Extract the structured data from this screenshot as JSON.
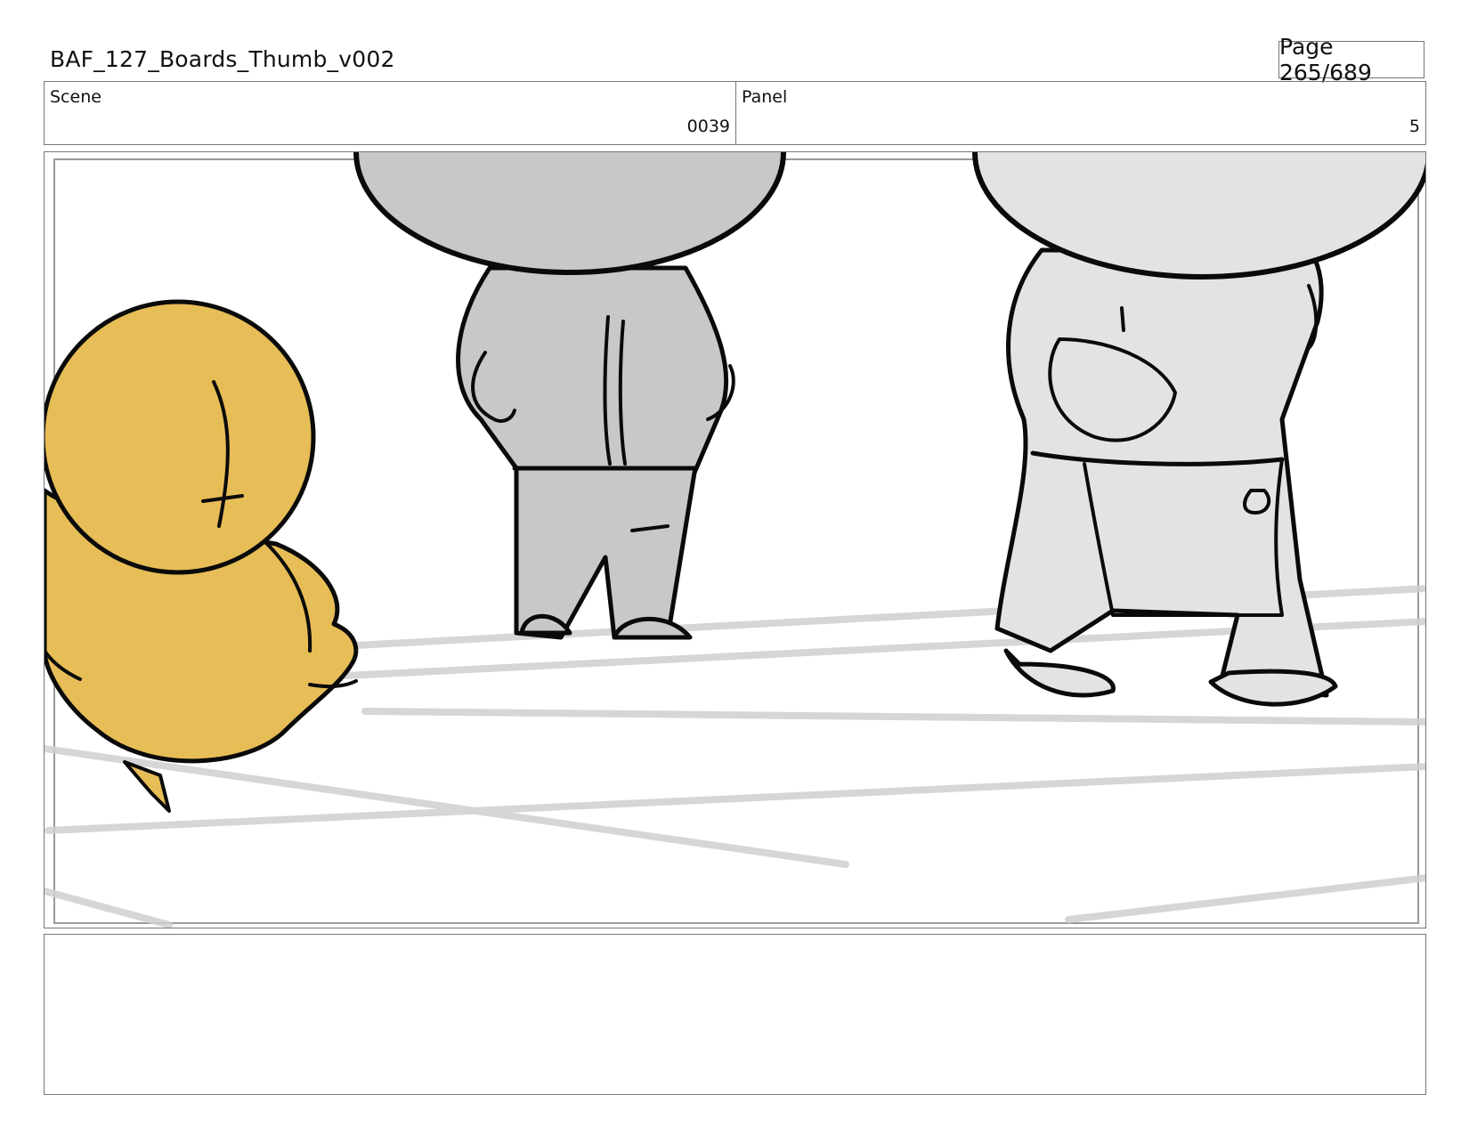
{
  "header": {
    "document_title": "BAF_127_Boards_Thumb_v002",
    "page_indicator": "Page 265/689"
  },
  "info": {
    "scene_label": "Scene",
    "scene_value": "0039",
    "panel_label": "Panel",
    "panel_value": "5"
  },
  "notes": {
    "text": ""
  },
  "colors": {
    "yellow_character": "#E6BD57",
    "gray_character_dark": "#C8C8C8",
    "gray_character_light": "#E3E3E3",
    "ink": "#0a0a0a",
    "floor_lines": "#cfcfcf"
  }
}
